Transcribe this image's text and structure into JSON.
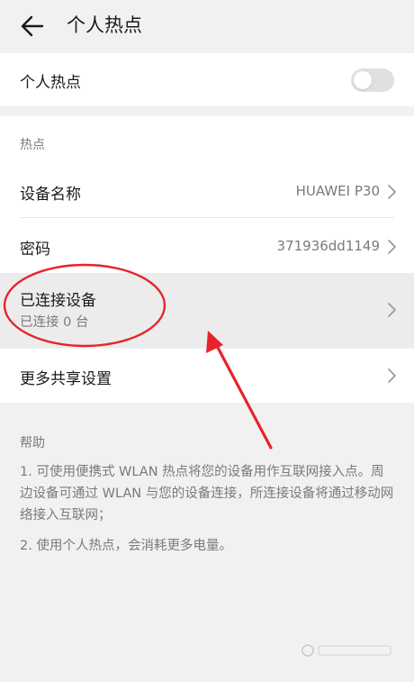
{
  "header": {
    "title": "个人热点"
  },
  "hotspot_toggle": {
    "label": "个人热点",
    "enabled": false
  },
  "hotspot_section": {
    "label": "热点",
    "device_name": {
      "label": "设备名称",
      "value": "HUAWEI P30"
    },
    "password": {
      "label": "密码",
      "value": "371936dd1149"
    },
    "connected": {
      "label": "已连接设备",
      "sub": "已连接 0 台"
    }
  },
  "more_settings": {
    "label": "更多共享设置"
  },
  "help": {
    "label": "帮助",
    "item1": "1. 可使用便携式 WLAN 热点将您的设备用作互联网接入点。周边设备可通过 WLAN 与您的设备连接，所连接设备将通过移动网络接入互联网；",
    "item2": "2. 使用个人热点，会消耗更多电量。"
  },
  "colors": {
    "annotation": "#e8232b",
    "toggle_off": "#e0e0e0",
    "background": "#f1f1f1"
  },
  "icons": {
    "back": "arrow-left-icon",
    "chevron": "chevron-right-icon"
  }
}
